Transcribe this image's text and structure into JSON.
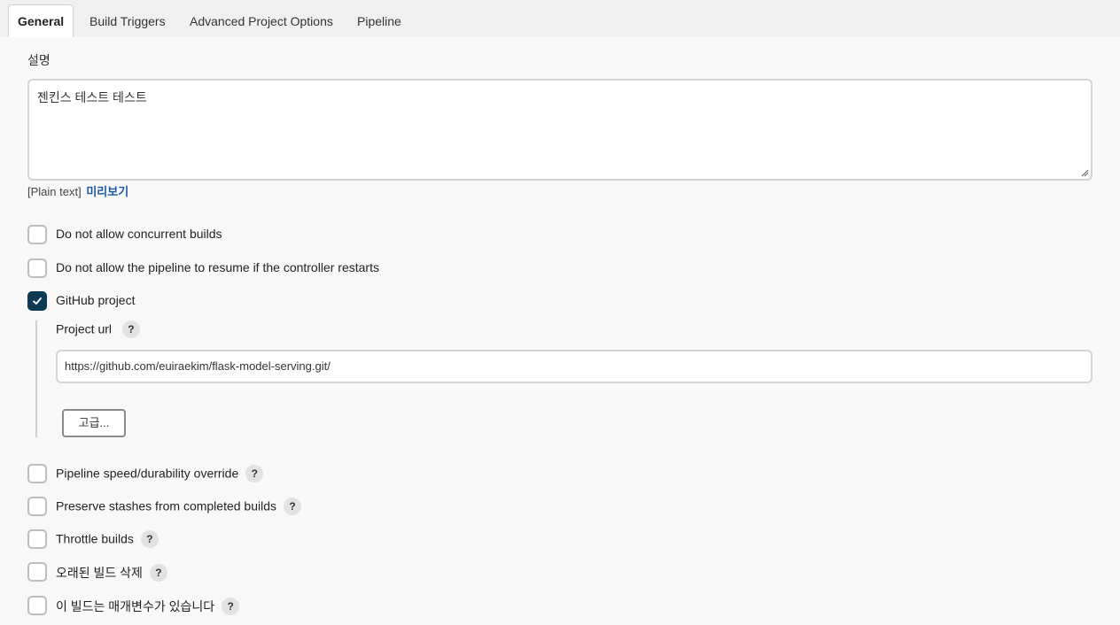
{
  "tabs": [
    {
      "label": "General",
      "active": true
    },
    {
      "label": "Build Triggers",
      "active": false
    },
    {
      "label": "Advanced Project Options",
      "active": false
    },
    {
      "label": "Pipeline",
      "active": false
    }
  ],
  "description": {
    "label": "설명",
    "value": "젠킨스 테스트 테스트",
    "format_text": "[Plain text]",
    "preview_link": "미리보기"
  },
  "options": {
    "concurrent": {
      "label": "Do not allow concurrent builds",
      "checked": false
    },
    "resume": {
      "label": "Do not allow the pipeline to resume if the controller restarts",
      "checked": false
    },
    "github": {
      "label": "GitHub project",
      "checked": true
    },
    "durability": {
      "label": "Pipeline speed/durability override",
      "checked": false
    },
    "stashes": {
      "label": "Preserve stashes from completed builds",
      "checked": false
    },
    "throttle": {
      "label": "Throttle builds",
      "checked": false
    },
    "discard": {
      "label": "오래된 빌드 삭제",
      "checked": false
    },
    "params": {
      "label": "이 빌드는 매개변수가 있습니다",
      "checked": false
    }
  },
  "github_project": {
    "url_label": "Project url",
    "url_value": "https://github.com/euiraekim/flask-model-serving.git/",
    "advanced_button": "고급..."
  },
  "help_glyph": "?",
  "colors": {
    "accent_checkbox": "#0b3a55",
    "link": "#1a59a6"
  }
}
